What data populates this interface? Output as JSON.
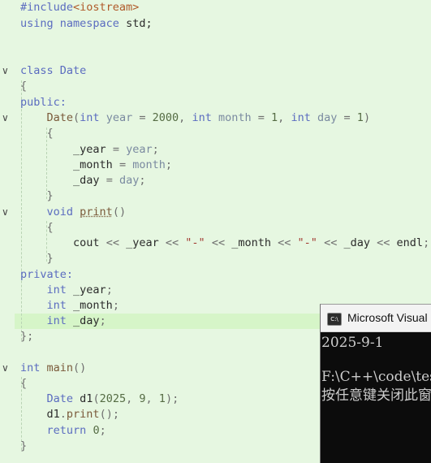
{
  "code": {
    "include_directive": "#include",
    "include_header": "<iostream>",
    "using_kw": "using",
    "namespace_kw": "namespace",
    "std": "std",
    "semicolon": ";",
    "class_kw": "class",
    "class_name": "Date",
    "open_brace": "{",
    "close_brace": "}",
    "close_brace_semi": "};",
    "public_label": "public:",
    "private_label": "private:",
    "int_kw": "int",
    "void_kw": "void",
    "return_kw": "return",
    "cout": "cout",
    "endl": "endl",
    "shift_op": "<<",
    "dash_str": "\"-\"",
    "param_year": "year",
    "param_month": "month",
    "param_day": "day",
    "member_year": "_year",
    "member_month": "_month",
    "member_day": "_day",
    "default_year": "2000",
    "default_month": "1",
    "default_day": "1",
    "print_fn": "print",
    "main_fn": "main",
    "obj_name": "d1",
    "arg_year": "2025",
    "arg_month": "9",
    "arg_day": "1",
    "zero": "0"
  },
  "console": {
    "title": "Microsoft Visual Studio Debug Console",
    "icon": "console-app-icon",
    "icon_text": "C:\\",
    "output_lines": [
      "2025-9-1",
      "",
      "F:\\C++\\code\\test",
      "按任意键关闭此窗口. . ."
    ]
  },
  "colors": {
    "editor_bg": "#e6f7e1",
    "keyword": "#5b6cc0",
    "function": "#7a5a3a",
    "variable": "#7a8aa0",
    "string": "#a23b32",
    "console_bg": "#0c0c0c",
    "console_fg": "#cccccc"
  }
}
